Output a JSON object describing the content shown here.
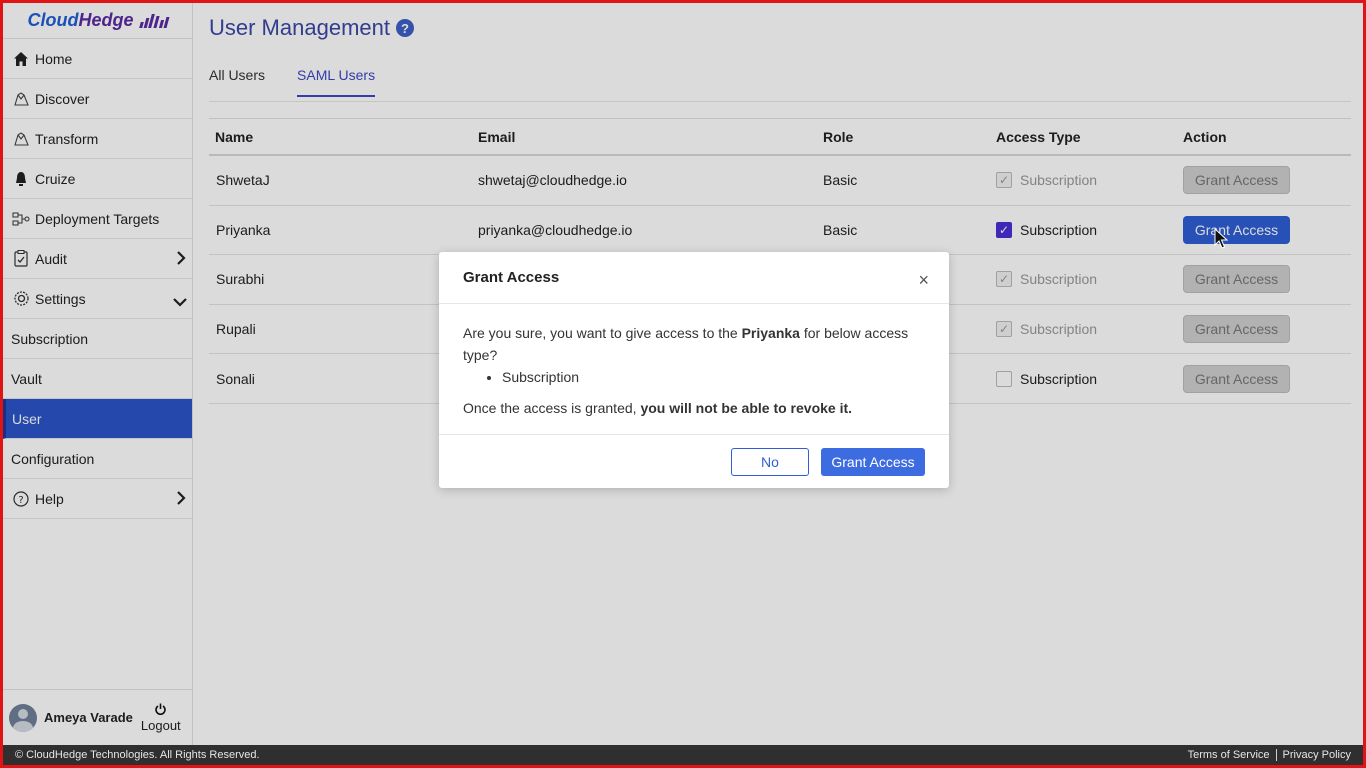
{
  "sidebar": {
    "logo": {
      "part1": "Cloud",
      "part2": "Hedge"
    },
    "items": [
      {
        "label": "Home",
        "icon": "home-icon"
      },
      {
        "label": "Discover",
        "icon": "discover-icon"
      },
      {
        "label": "Transform",
        "icon": "transform-icon"
      },
      {
        "label": "Cruize",
        "icon": "cruize-icon"
      },
      {
        "label": "Deployment Targets",
        "icon": "deployment-icon"
      },
      {
        "label": "Audit",
        "icon": "audit-icon"
      },
      {
        "label": "Settings",
        "icon": "settings-icon"
      },
      {
        "label": "Subscription"
      },
      {
        "label": "Vault"
      },
      {
        "label": "User",
        "active": true
      },
      {
        "label": "Configuration"
      },
      {
        "label": "Help",
        "icon": "help-icon"
      }
    ],
    "user_name": "Ameya Varade",
    "logout_label": "Logout"
  },
  "page": {
    "title": "User Management",
    "help_glyph": "?",
    "tabs": [
      {
        "label": "All Users"
      },
      {
        "label": "SAML Users",
        "active": true
      }
    ]
  },
  "table": {
    "headers": {
      "name": "Name",
      "email": "Email",
      "role": "Role",
      "access": "Access Type",
      "action": "Action"
    },
    "rows": [
      {
        "name": "ShwetaJ",
        "email": "shwetaj@cloudhedge.io",
        "role": "Basic",
        "access": "Subscription",
        "checked": true,
        "disabled": true,
        "action": "Grant Access"
      },
      {
        "name": "Priyanka",
        "email": "priyanka@cloudhedge.io",
        "role": "Basic",
        "access": "Subscription",
        "checked": true,
        "disabled": false,
        "action": "Grant Access"
      },
      {
        "name": "Surabhi",
        "email": "",
        "role": "",
        "access": "Subscription",
        "checked": true,
        "disabled": true,
        "action": "Grant Access"
      },
      {
        "name": "Rupali",
        "email": "",
        "role": "",
        "access": "Subscription",
        "checked": true,
        "disabled": true,
        "action": "Grant Access"
      },
      {
        "name": "Sonali",
        "email": "",
        "role": "",
        "access": "Subscription",
        "checked": false,
        "disabled": true,
        "action": "Grant Access"
      }
    ]
  },
  "modal": {
    "title": "Grant Access",
    "close_glyph": "×",
    "text_before": "Are you sure, you want to give access to the ",
    "user": "Priyanka",
    "text_after": " for below access type?",
    "items": [
      "Subscription"
    ],
    "note_before": "Once the access is granted, ",
    "note_bold": "you will not be able to revoke it.",
    "no_label": "No",
    "confirm_label": "Grant Access"
  },
  "footer": {
    "copyright": "© CloudHedge Technologies. All Rights Reserved.",
    "terms": "Terms of Service",
    "privacy": "Privacy Policy"
  },
  "colors": {
    "accent": "#2f5fd6",
    "active_nav": "#2b54c9",
    "title": "#3b47a8",
    "checkbox_on": "#4a2fd6",
    "frame": "#e01414"
  }
}
